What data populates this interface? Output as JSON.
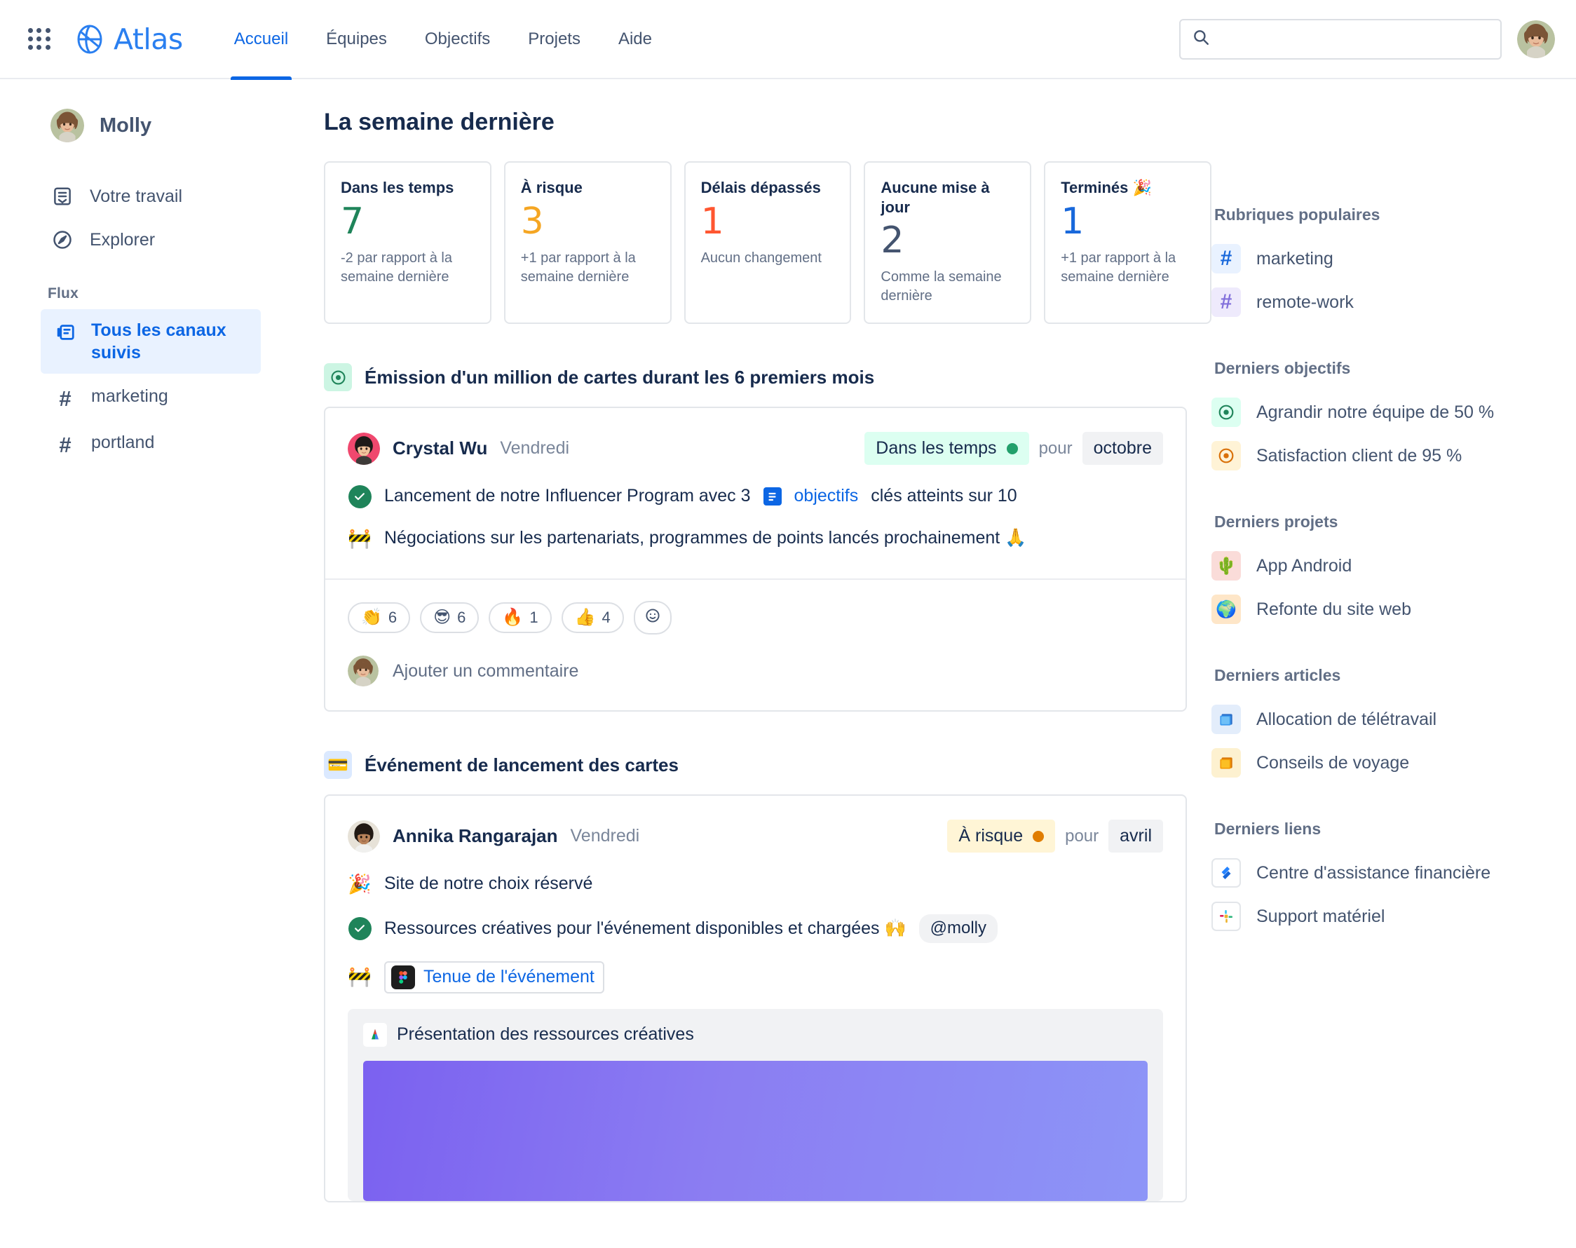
{
  "header": {
    "app_switcher_icon": "waffle-grid-icon",
    "brand": "Atlas",
    "nav": [
      {
        "label": "Accueil",
        "active": true
      },
      {
        "label": "Équipes",
        "active": false
      },
      {
        "label": "Objectifs",
        "active": false
      },
      {
        "label": "Projets",
        "active": false
      },
      {
        "label": "Aide",
        "active": false
      }
    ],
    "search": {
      "value": "",
      "placeholder": ""
    },
    "avatar_alt": "Molly"
  },
  "sidebar": {
    "profile_name": "Molly",
    "links": [
      {
        "label": "Votre travail",
        "icon": "your-work-icon"
      },
      {
        "label": "Explorer",
        "icon": "compass-icon"
      }
    ],
    "section_title": "Flux",
    "flux": [
      {
        "label": "Tous les canaux suivis",
        "icon": "feed-icon",
        "active": true
      },
      {
        "label": "marketing",
        "icon": "hash-icon",
        "active": false
      },
      {
        "label": "portland",
        "icon": "hash-icon",
        "active": false
      }
    ]
  },
  "main": {
    "title": "La semaine dernière",
    "stats": [
      {
        "label": "Dans les temps",
        "value": "7",
        "color": "#1f845a",
        "sub": "-2 par rapport à la semaine dernière"
      },
      {
        "label": "À risque",
        "value": "3",
        "color": "#f5a623",
        "sub": "+1 par rapport à la semaine dernière"
      },
      {
        "label": "Délais dépassés",
        "value": "1",
        "color": "#ff5630",
        "sub": "Aucun changement"
      },
      {
        "label": "Aucune mise à jour",
        "value": "2",
        "color": "#44546f",
        "sub": "Comme la semaine dernière"
      },
      {
        "label": "Terminés 🎉",
        "value": "1",
        "color": "#1868db",
        "sub": "+1 par rapport à la semaine dernière"
      }
    ],
    "posts": [
      {
        "heading": "Émission d'un million de cartes durant les 6 premiers mois",
        "heading_icon": "goal-target-icon",
        "author": "Crystal Wu",
        "date": "Vendredi",
        "status": "Dans les temps",
        "status_tone": "green",
        "for_word": "pour",
        "period": "octobre",
        "line1_before": "Lancement de notre Influencer Program avec 3",
        "line1_link": "objectifs",
        "line1_after": "clés atteints sur 10",
        "line2": "Négociations sur les partenariats, programmes de points lancés prochainement 🙏",
        "reactions": [
          {
            "emoji": "👏",
            "count": "6"
          },
          {
            "emoji": "😎",
            "count": "6"
          },
          {
            "emoji": "🔥",
            "count": "1"
          },
          {
            "emoji": "👍",
            "count": "4"
          }
        ],
        "add_reaction_icon": "add-reaction-icon",
        "comment_placeholder": "Ajouter un commentaire"
      },
      {
        "heading": "Événement de lancement des cartes",
        "heading_icon": "credit-card-icon",
        "author": "Annika Rangarajan",
        "date": "Vendredi",
        "status": "À risque",
        "status_tone": "yellow",
        "for_word": "pour",
        "period": "avril",
        "line1": "Site de notre choix réservé",
        "line1_emoji": "🎉",
        "line2": "Ressources créatives pour l'événement disponibles et chargées 🙌",
        "line2_mention": "@molly",
        "line3_link": "Tenue de l'événement",
        "line3_link_icon": "figma-icon",
        "embed_title": "Présentation des ressources créatives",
        "embed_icon": "google-drive-icon"
      }
    ]
  },
  "rail": {
    "groups": [
      {
        "title": "Rubriques populaires",
        "items": [
          {
            "label": "marketing",
            "icon": "hash-icon",
            "tone": "blue"
          },
          {
            "label": "remote-work",
            "icon": "hash-icon",
            "tone": "purple"
          }
        ]
      },
      {
        "title": "Derniers objectifs",
        "items": [
          {
            "label": "Agrandir notre équipe de 50 %",
            "icon": "goal-target-icon",
            "tone": "green"
          },
          {
            "label": "Satisfaction client de 95 %",
            "icon": "goal-target-icon",
            "tone": "orange"
          }
        ]
      },
      {
        "title": "Derniers projets",
        "items": [
          {
            "label": "App Android",
            "icon": "cactus-emoji",
            "tone": "pink"
          },
          {
            "label": "Refonte du site web",
            "icon": "earth-emoji",
            "tone": "peach"
          }
        ]
      },
      {
        "title": "Derniers articles",
        "items": [
          {
            "label": "Allocation de télétravail",
            "icon": "blue-books-emoji",
            "tone": "lightblue"
          },
          {
            "label": "Conseils de voyage",
            "icon": "orange-books-emoji",
            "tone": "lightyellow"
          }
        ]
      },
      {
        "title": "Derniers liens",
        "items": [
          {
            "label": "Centre d'assistance financière",
            "icon": "jira-icon",
            "tone": "plain"
          },
          {
            "label": "Support matériel",
            "icon": "slack-icon",
            "tone": "plain"
          }
        ]
      }
    ]
  },
  "colors": {
    "accent": "#0c66e4",
    "brand_blue": "#2a7ff0",
    "green": "#1f845a",
    "yellow": "#f5a623",
    "red": "#ff5630",
    "slate": "#44546f"
  }
}
